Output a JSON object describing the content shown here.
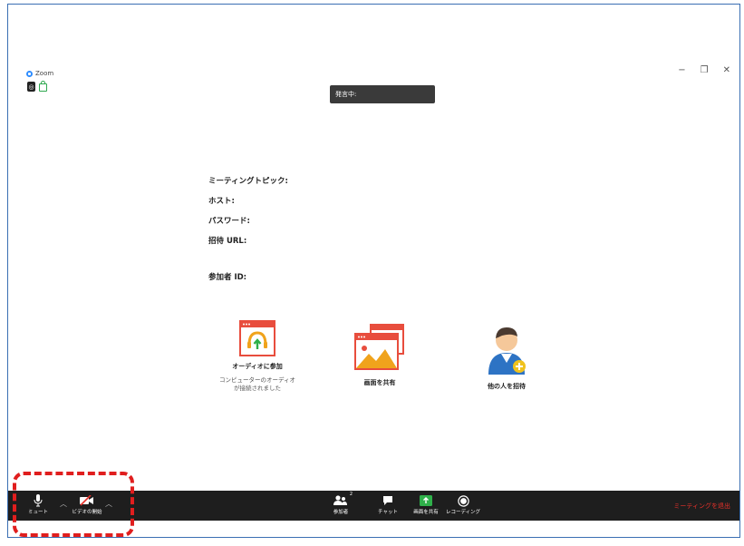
{
  "window": {
    "app_name": "Zoom",
    "minimize": "−",
    "restore": "❐",
    "close": "✕"
  },
  "speaking_label": "発言中:",
  "meeting_info": {
    "topic_label": "ミーティングトピック:",
    "host_label": "ホスト:",
    "password_label": "パスワード:",
    "invite_url_label": "招待 URL:",
    "participant_id_label": "参加者 ID:"
  },
  "actions": {
    "join_audio": {
      "label": "オーディオに参加",
      "sub": "コンピューターのオーディオが接続されました"
    },
    "share_screen": {
      "label": "画面を共有"
    },
    "invite_others": {
      "label": "他の人を招待"
    }
  },
  "toolbar": {
    "mute": "ミュート",
    "start_video": "ビデオの開始",
    "participants": "参加者",
    "participants_count": "2",
    "chat": "チャット",
    "share_screen": "画面を共有",
    "recording": "レコーディング",
    "end_meeting": "ミーティングを退出"
  },
  "colors": {
    "toolbar_bg": "#1e1e1e",
    "accent_red": "#e8312a",
    "zoom_blue": "#2d8cff",
    "share_green": "#2fb04a"
  }
}
